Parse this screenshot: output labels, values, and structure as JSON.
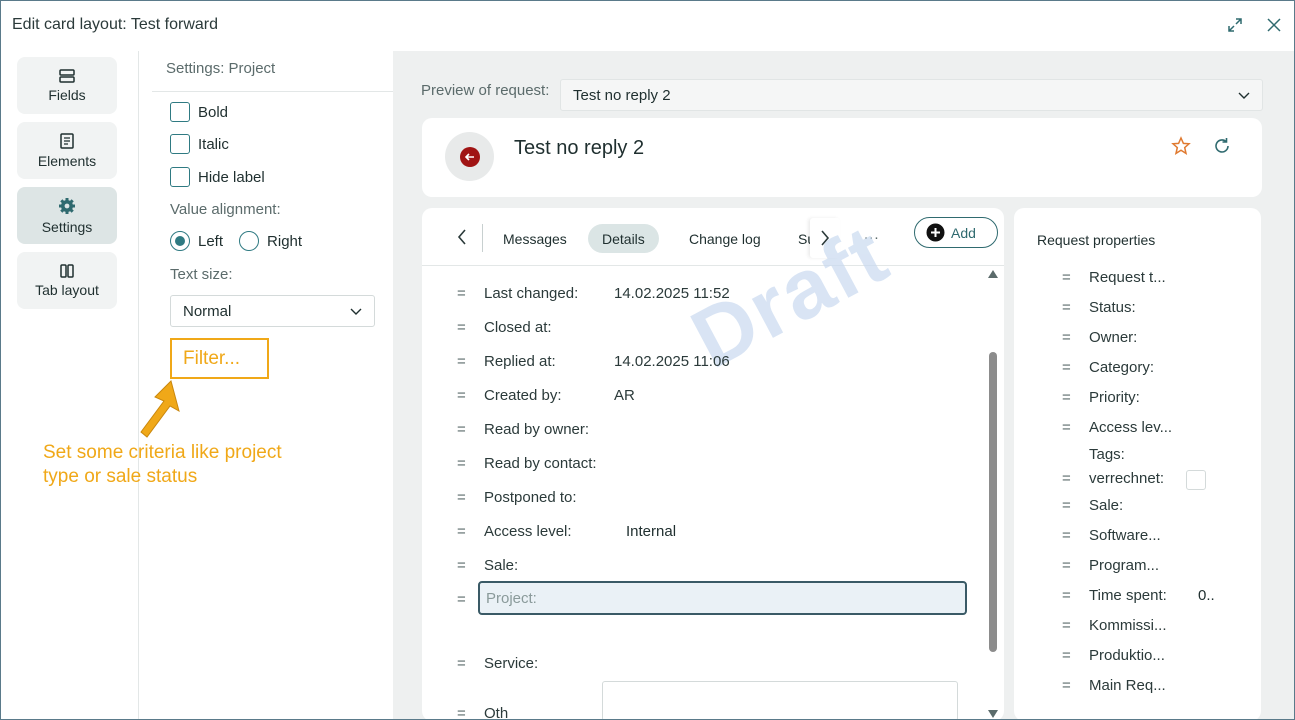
{
  "window": {
    "title": "Edit card layout: Test forward",
    "icons": {
      "expand": "expand-icon",
      "close": "close-icon"
    }
  },
  "nav": [
    {
      "label": "Fields",
      "icon": "fields-icon",
      "active": false
    },
    {
      "label": "Elements",
      "icon": "elements-icon",
      "active": false
    },
    {
      "label": "Settings",
      "icon": "gear-icon",
      "active": true
    },
    {
      "label": "Tab layout",
      "icon": "columns-icon",
      "active": false
    }
  ],
  "settings": {
    "heading": "Settings: Project",
    "checkboxes": [
      {
        "label": "Bold",
        "checked": false
      },
      {
        "label": "Italic",
        "checked": false
      },
      {
        "label": "Hide label",
        "checked": false
      }
    ],
    "value_alignment_label": "Value alignment:",
    "alignment_options": [
      {
        "label": "Left",
        "checked": true
      },
      {
        "label": "Right",
        "checked": false
      }
    ],
    "text_size_label": "Text size:",
    "text_size_value": "Normal",
    "filter_label": "Filter..."
  },
  "annotation": {
    "line1": "Set some criteria like project",
    "line2": "type or sale status",
    "color": "#f0a818"
  },
  "preview": {
    "label": "Preview of request:",
    "selected": "Test no reply 2",
    "request_title": "Test no reply 2",
    "tabs": [
      "Messages",
      "Details",
      "Change log",
      "Su"
    ],
    "active_tab": "Details",
    "more": "...",
    "add_label": "Add",
    "watermark": "Draft",
    "details": [
      {
        "label": "Last changed:",
        "value": "14.02.2025 11:52"
      },
      {
        "label": "Closed at:",
        "value": ""
      },
      {
        "label": "Replied at:",
        "value": "14.02.2025 11:06"
      },
      {
        "label": "Created by:",
        "value": "AR"
      },
      {
        "label": "Read by owner:",
        "value": ""
      },
      {
        "label": "Read by contact:",
        "value": ""
      },
      {
        "label": "Postponed to:",
        "value": ""
      },
      {
        "label": "Access level:",
        "value": "Internal"
      },
      {
        "label": "Sale:",
        "value": ""
      }
    ],
    "project_label": "Project:",
    "service_label": "Service:",
    "truncated_label": "Oth",
    "properties_heading": "Request properties",
    "properties": [
      {
        "label": "Request t...",
        "value": ""
      },
      {
        "label": "Status:",
        "value": ""
      },
      {
        "label": "Owner:",
        "value": ""
      },
      {
        "label": "Category:",
        "value": ""
      },
      {
        "label": "Priority:",
        "value": ""
      },
      {
        "label": "Access lev...",
        "value": ""
      },
      {
        "label": "Tags:",
        "value": ""
      },
      {
        "label": "verrechnet:",
        "value": ""
      },
      {
        "label": "Sale:",
        "value": ""
      },
      {
        "label": "Software...",
        "value": ""
      },
      {
        "label": "Program...",
        "value": ""
      },
      {
        "label": "Time spent:",
        "value": "0.."
      },
      {
        "label": "Kommissi...",
        "value": ""
      },
      {
        "label": "Produktio...",
        "value": ""
      },
      {
        "label": "Main Req...",
        "value": ""
      }
    ]
  },
  "colors": {
    "accent": "#2f7a82",
    "highlight": "#f0a818",
    "back_button": "#a01414",
    "star": "#e07a30"
  }
}
